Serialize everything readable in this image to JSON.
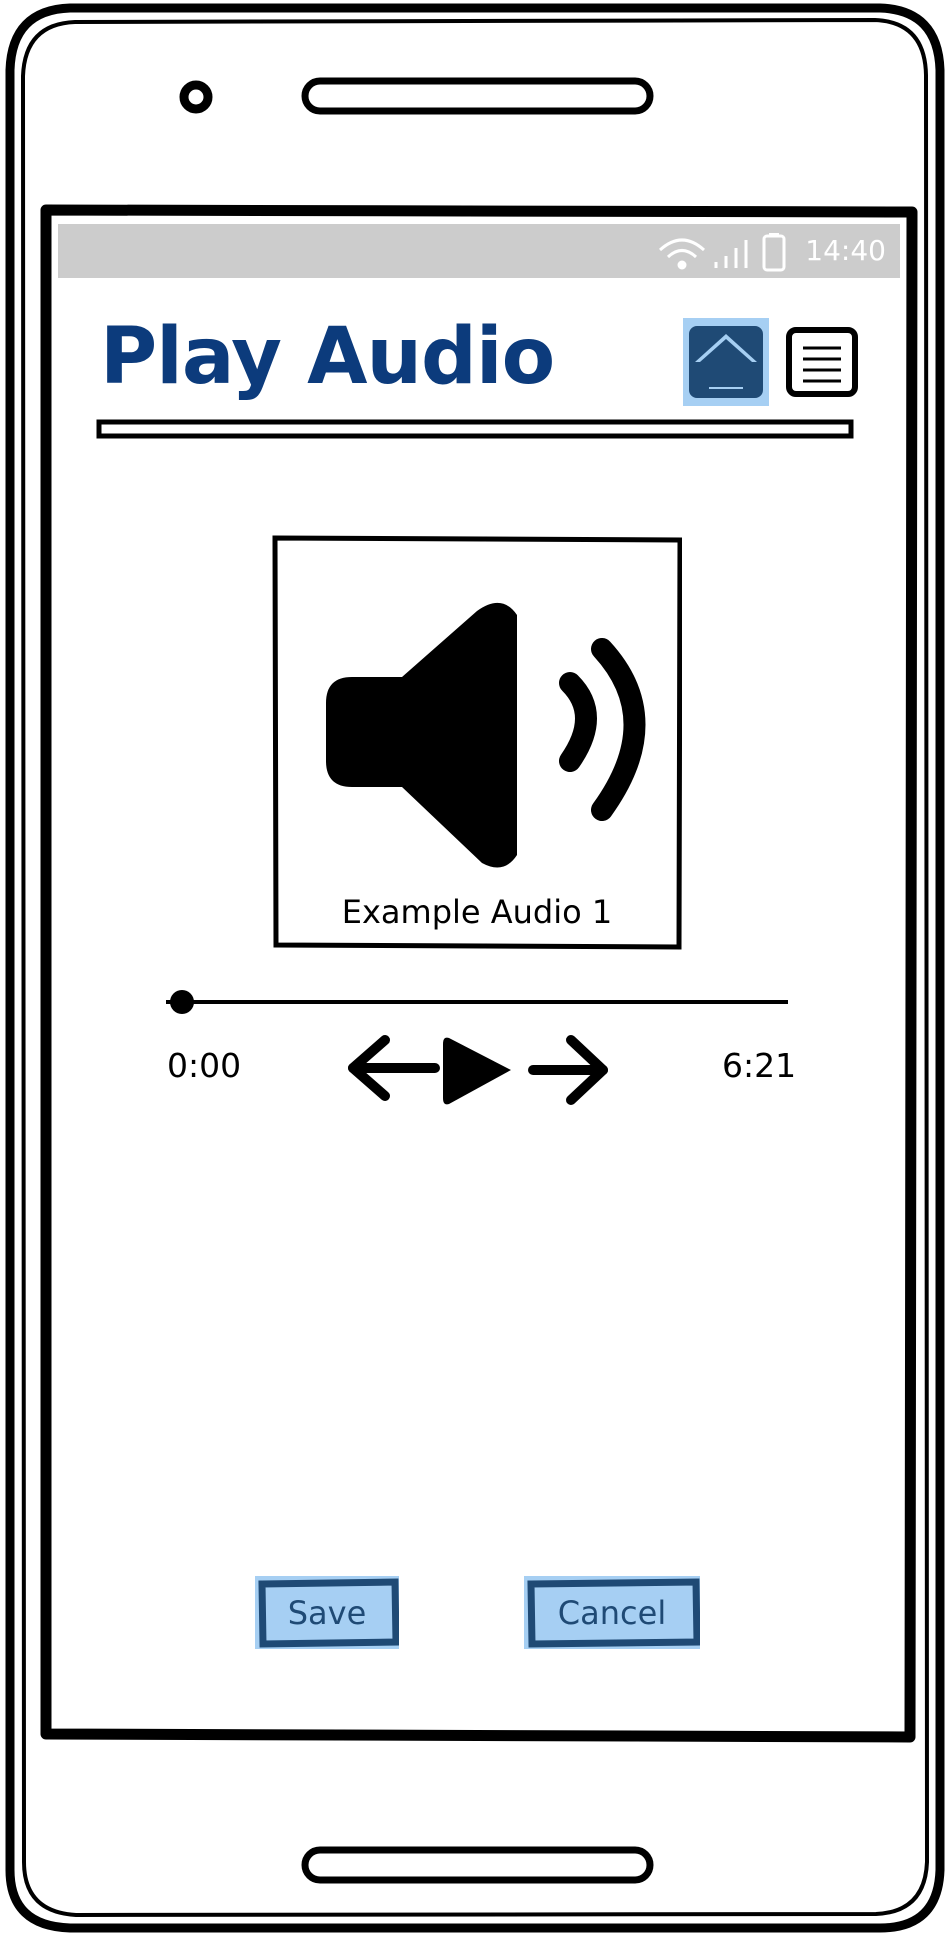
{
  "status_bar": {
    "time": "14:40"
  },
  "header": {
    "title": "Play Audio"
  },
  "media": {
    "caption": "Example Audio 1"
  },
  "player": {
    "current_time": "0:00",
    "total_time": "6:21",
    "progress": 0
  },
  "actions": {
    "save_label": "Save",
    "cancel_label": "Cancel"
  },
  "colors": {
    "accent": "#0c3b7c",
    "button_bg": "#a6cff3",
    "button_dark": "#1f4a75",
    "status_bar": "#cccccc"
  },
  "icons": [
    "home-icon",
    "menu-icon",
    "speaker-icon",
    "previous-icon",
    "play-icon",
    "next-icon",
    "wifi-icon",
    "signal-icon",
    "battery-icon"
  ]
}
